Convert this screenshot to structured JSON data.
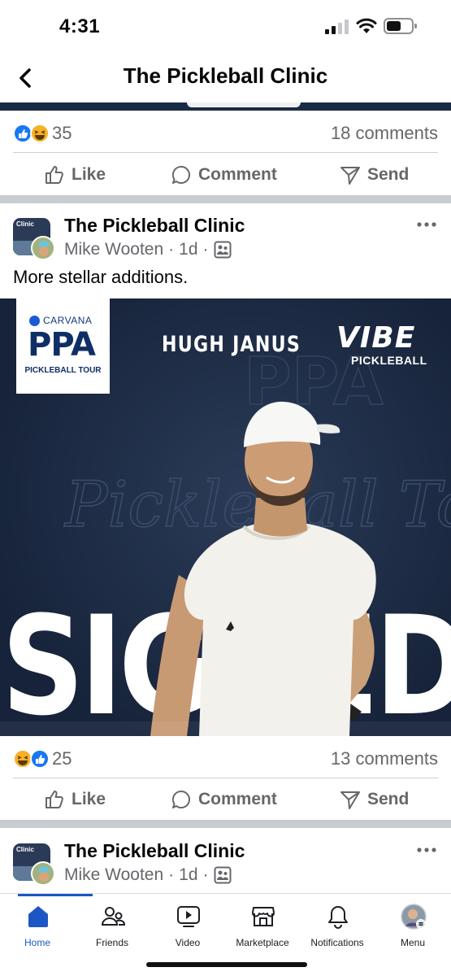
{
  "status_bar": {
    "time": "4:31"
  },
  "header": {
    "title": "The Pickleball Clinic"
  },
  "prev_post": {
    "reaction_count": "35",
    "comments": "18 comments",
    "actions": {
      "like": "Like",
      "comment": "Comment",
      "send": "Send"
    }
  },
  "post": {
    "page_name": "The Pickleball Clinic",
    "author": "Mike Wooten",
    "time": "1d",
    "caption": "More stellar additions.",
    "image": {
      "carvana": "CARVANA",
      "ppa": "PPA",
      "tour": "PICKLEBALL TOUR",
      "player_name": "HUGH JANUS",
      "brand": "VIBE",
      "brand_sub": "PICKLEBALL",
      "headline": "SIGNED"
    },
    "reaction_count": "25",
    "comments": "13 comments",
    "actions": {
      "like": "Like",
      "comment": "Comment",
      "send": "Send"
    }
  },
  "next_post": {
    "page_name": "The Pickleball Clinic",
    "author": "Mike Wooten",
    "time": "1d"
  },
  "nav": {
    "home": "Home",
    "friends": "Friends",
    "video": "Video",
    "marketplace": "Marketplace",
    "notifications": "Notifications",
    "menu": "Menu"
  },
  "colors": {
    "accent": "#1b57c4",
    "secondary_text": "#65676b",
    "separator": "#c9ccd1",
    "image_bg": "#1b2940"
  }
}
